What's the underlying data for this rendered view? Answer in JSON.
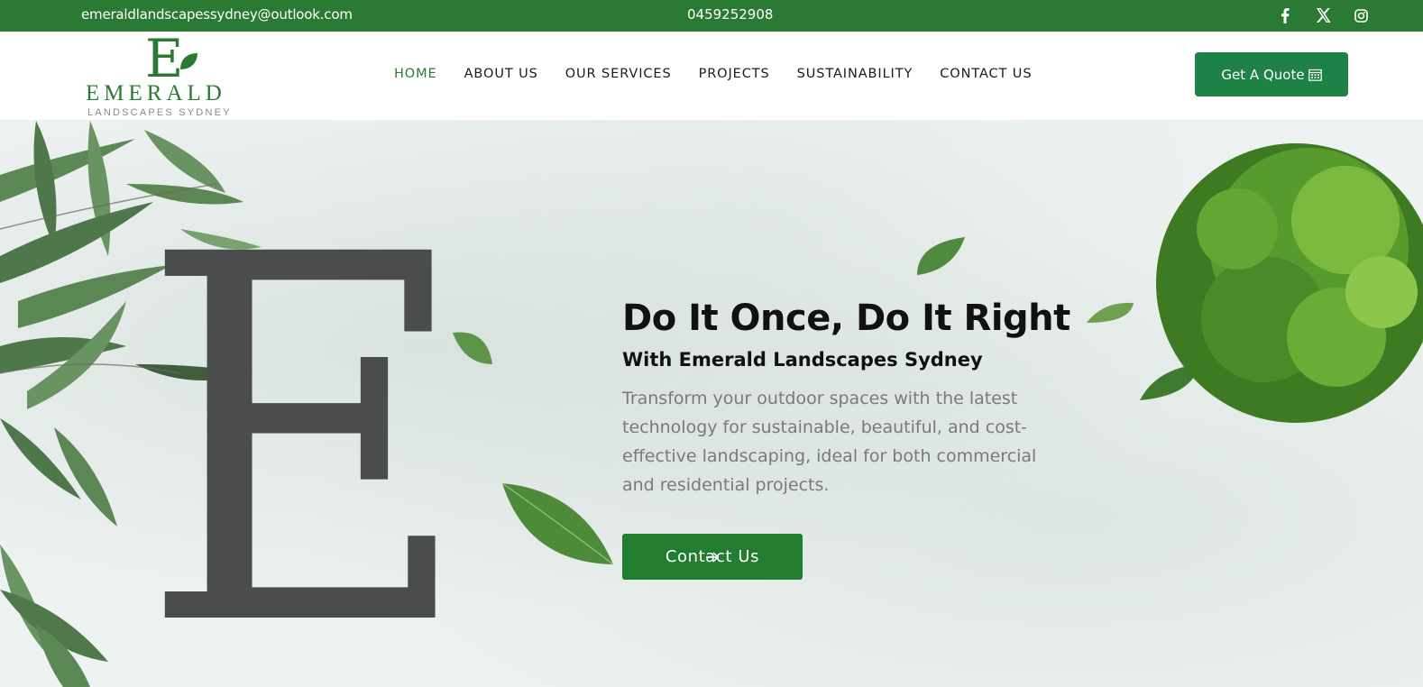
{
  "topbar": {
    "email": "emeraldlandscapessydney@outlook.com",
    "phone": "0459252908",
    "social": [
      "facebook-icon",
      "x-icon",
      "instagram-icon"
    ]
  },
  "logo": {
    "mark": "E",
    "word": "EMERALD",
    "sub": "LANDSCAPES SYDNEY"
  },
  "nav": {
    "items": [
      {
        "label": "HOME",
        "active": true
      },
      {
        "label": "ABOUT US"
      },
      {
        "label": "OUR SERVICES"
      },
      {
        "label": "PROJECTS"
      },
      {
        "label": "SUSTAINABILITY"
      },
      {
        "label": "CONTACT US"
      }
    ]
  },
  "header": {
    "quote_label": "Get A Quote",
    "quote_icon": "calendar-icon"
  },
  "hero": {
    "big_letter": "E",
    "title": "Do It Once, Do It Right",
    "subtitle": "With Emerald Landscapes Sydney",
    "description": "Transform your outdoor spaces with the latest technology for sustainable, beautiful, and cost-effective landscaping, ideal for both commercial and residential projects.",
    "cta_label": "Contact Us",
    "cta_icon": "arrow-right-icon"
  },
  "colors": {
    "brand_green": "#2b7a33",
    "button_green": "#1e8146",
    "text_dark": "#111111",
    "text_muted": "#7a7a7a"
  }
}
